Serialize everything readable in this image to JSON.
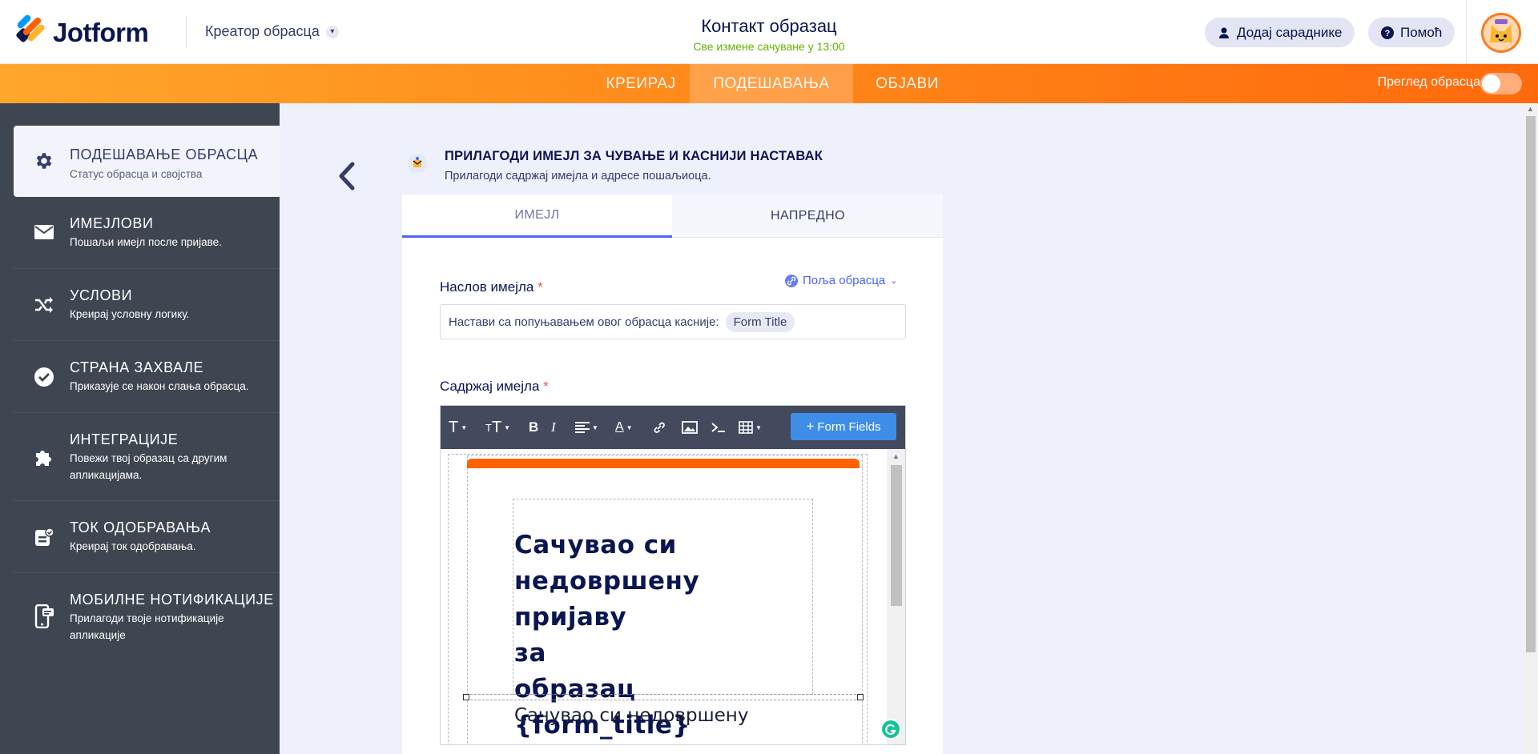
{
  "app": {
    "brand": "Jotform",
    "creator_label": "Креатор обрасца",
    "form_title": "Контакт образац",
    "saved_status": "Све измене сачуване у 13:00",
    "add_collaborators": "Додај сараднике",
    "help": "Помоћ"
  },
  "nav": {
    "tabs": [
      "КРЕИРАЈ",
      "ПОДЕШАВАЊА",
      "ОБЈАВИ"
    ],
    "active_tab": "ПОДЕШАВАЊА",
    "preview_label": "Преглед обрасца",
    "preview_enabled": false
  },
  "sidebar": {
    "items": [
      {
        "title": "ПОДЕШАВАЊЕ ОБРАСЦА",
        "subtitle": "Статус обрасца и својства",
        "icon": "gear-icon",
        "active": true
      },
      {
        "title": "ИМЕЈЛОВИ",
        "subtitle": "Пошаљи имејл после пријаве.",
        "icon": "envelope-icon",
        "active": false
      },
      {
        "title": "УСЛОВИ",
        "subtitle": "Креирај условну логику.",
        "icon": "shuffle-icon",
        "active": false
      },
      {
        "title": "СТРАНА ЗАХВАЛЕ",
        "subtitle": "Приказује се након слања обрасца.",
        "icon": "check-circle-icon",
        "active": false
      },
      {
        "title": "ИНТЕГРАЦИЈЕ",
        "subtitle": "Повежи твој образац са другим апликацијама.",
        "icon": "puzzle-icon",
        "active": false
      },
      {
        "title": "ТОК ОДОБРАВАЊА",
        "subtitle": "Креирај ток одобравања.",
        "icon": "approval-icon",
        "active": false
      },
      {
        "title": "МОБИЛНЕ НОТИФИКАЦИЈЕ",
        "subtitle": "Прилагоди твоје нотификације апликације",
        "icon": "mobile-notification-icon",
        "active": false
      }
    ]
  },
  "panel": {
    "title": "ПРИЛАГОДИ ИМЕЈЛ ЗА ЧУВАЊЕ И КАСНИЈИ НАСТАВАК",
    "subtitle": "Прилагоди садржај имејла и адресе пошаљиоца.",
    "tabs": [
      "ИМЕЈЛ",
      "НАПРЕДНО"
    ],
    "active_tab": "ИМЕЈЛ",
    "subject_label": "Наслов имејла",
    "form_fields_link": "Поља обрасца",
    "subject_text": "Настави са попуњавањем овог обрасца касније:",
    "subject_chip": "Form Title",
    "content_label": "Садржај имејла",
    "required_mark": "*"
  },
  "editor": {
    "form_fields_button": "Form Fields",
    "heading_lines": [
      "Сачувао си",
      "недовршену пријаву",
      "за",
      "образац {form_title}"
    ],
    "body_text": "Сачувао си недовршену"
  },
  "colors": {
    "brand_orange": "#ff6100",
    "sidebar_bg": "#3e4652",
    "accent_blue": "#4c63ff",
    "saved_green": "#64b200"
  }
}
